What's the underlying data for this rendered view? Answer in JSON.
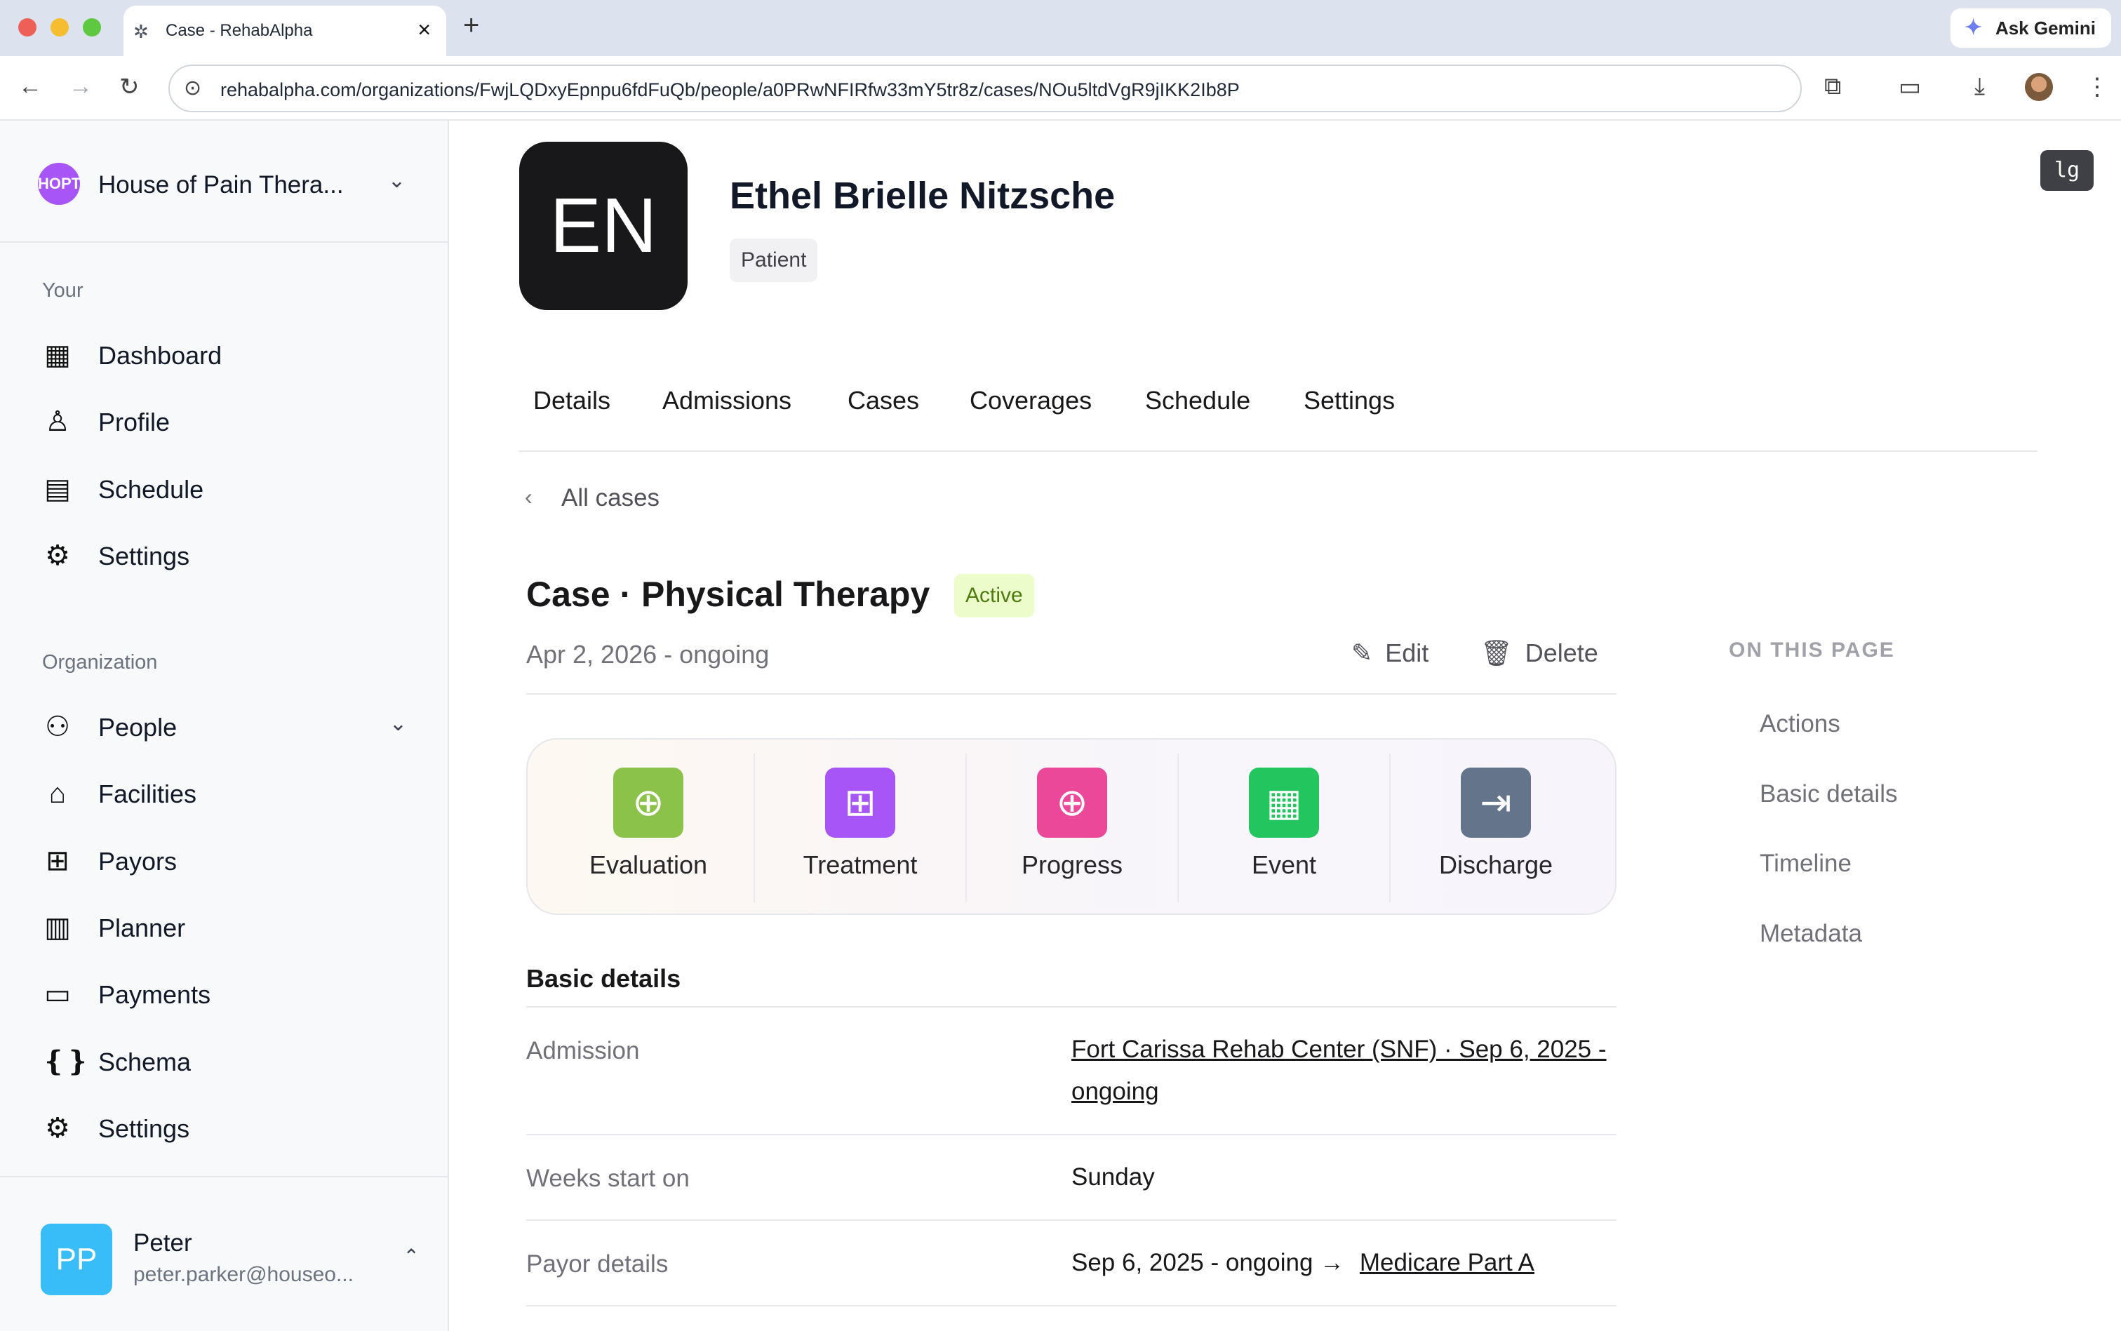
{
  "browser": {
    "tab_title": "Case - RehabAlpha",
    "url": "rehabalpha.com/organizations/FwjLQDxyEpnpu6fdFuQb/people/a0PRwNFIRfw33mY5tr8z/cases/NOu5ltdVgR9jIKK2Ib8P",
    "gemini_label": "Ask Gemini"
  },
  "sidebar": {
    "org_name": "House of Pain Thera...",
    "org_logo": "HOPT",
    "your_label": "Your",
    "your_items": [
      {
        "label": "Dashboard",
        "icon": "dashboard-icon"
      },
      {
        "label": "Profile",
        "icon": "user-icon"
      },
      {
        "label": "Schedule",
        "icon": "calendar-icon"
      },
      {
        "label": "Settings",
        "icon": "gear-icon"
      }
    ],
    "org_label": "Organization",
    "org_items": [
      {
        "label": "People",
        "icon": "people-icon"
      },
      {
        "label": "Facilities",
        "icon": "building-icon"
      },
      {
        "label": "Payors",
        "icon": "clipboard-plus-icon"
      },
      {
        "label": "Planner",
        "icon": "calendar-grid-icon"
      },
      {
        "label": "Payments",
        "icon": "credit-card-icon"
      },
      {
        "label": "Schema",
        "icon": "schema-file-icon"
      },
      {
        "label": "Settings",
        "icon": "gear-icon"
      }
    ],
    "user": {
      "initials": "PP",
      "name": "Peter",
      "email": "peter.parker@houseo..."
    }
  },
  "patient": {
    "initials": "EN",
    "name": "Ethel Brielle Nitzsche",
    "badge": "Patient",
    "breakpoint_label": "lg"
  },
  "tabs": [
    "Details",
    "Admissions",
    "Cases",
    "Coverages",
    "Schedule",
    "Settings"
  ],
  "case": {
    "back_label": "All cases",
    "title": "Case · Physical Therapy",
    "status": "Active",
    "dates": "Apr 2, 2026 - ongoing",
    "edit_label": "Edit",
    "delete_label": "Delete",
    "actions": [
      {
        "label": "Evaluation",
        "color": "#8bc34a",
        "icon": "briefcase-plus-icon"
      },
      {
        "label": "Treatment",
        "color": "#a855f7",
        "icon": "clipboard-plus-icon"
      },
      {
        "label": "Progress",
        "color": "#ec4899",
        "icon": "file-plus-icon"
      },
      {
        "label": "Event",
        "color": "#22c55e",
        "icon": "calendar-plus-icon"
      },
      {
        "label": "Discharge",
        "color": "#64748b",
        "icon": "exit-icon"
      }
    ],
    "basic_details_title": "Basic details",
    "details": {
      "admission_label": "Admission",
      "admission_value": "Fort Carissa Rehab Center (SNF) · Sep 6, 2025 - ongoing",
      "weeks_label": "Weeks start on",
      "weeks_value": "Sunday",
      "payor_label": "Payor details",
      "payor_dates": "Sep 6, 2025 - ongoing →",
      "payor_link": "Medicare Part A"
    }
  },
  "on_this_page": {
    "title": "ON THIS PAGE",
    "items": [
      "Actions",
      "Basic details",
      "Timeline",
      "Metadata"
    ]
  }
}
